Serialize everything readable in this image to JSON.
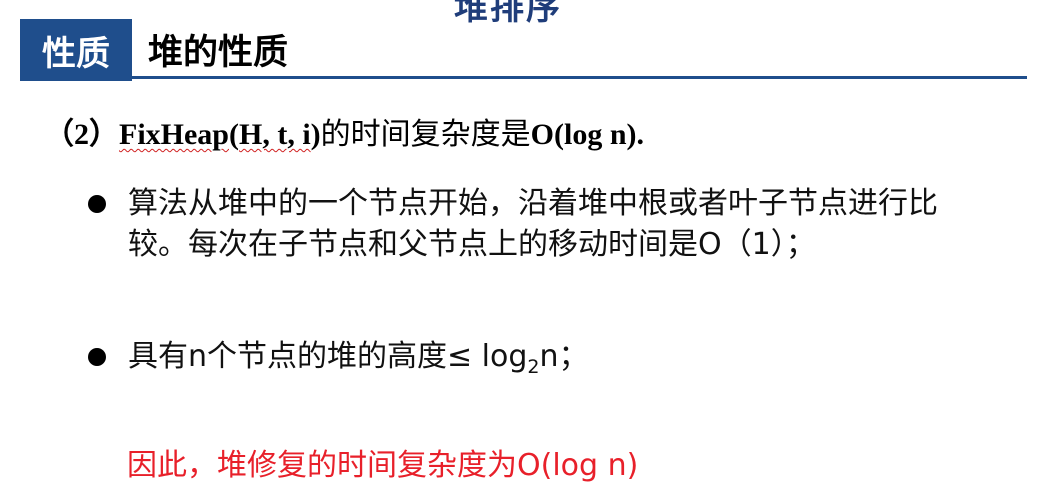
{
  "header": {
    "top_cut_text": "堆排序",
    "tag": "性质",
    "title": "堆的性质"
  },
  "heading": {
    "prefix": "（2）",
    "func": "FixHeap",
    "paren_open": "(",
    "args": "H, t, i",
    "paren_close": ")",
    "suffix_cn": "的时间复杂度是",
    "suffix_big_o": "O(log n)."
  },
  "bullets": [
    {
      "text": "算法从堆中的一个节点开始，沿着堆中根或者叶子节点进行比较。每次在子节点和父节点上的移动时间是O（1）；"
    },
    {
      "part1": "具有n个节点的堆的高度≤ log",
      "sub": "2",
      "part2": "n；"
    }
  ],
  "conclusion": "因此，堆修复的时间复杂度为O(log n)",
  "colors": {
    "accent": "#1f4e8c",
    "conclusion": "#e8202a"
  }
}
